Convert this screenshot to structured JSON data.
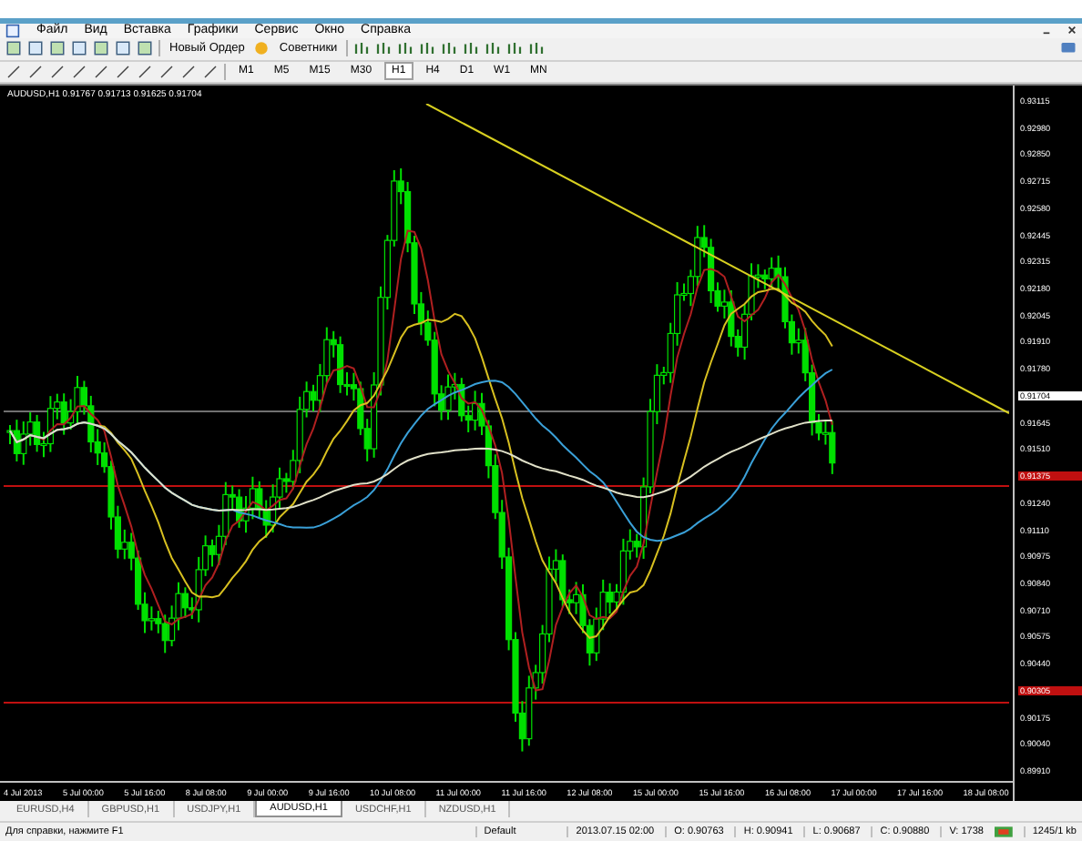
{
  "menu": [
    "Файл",
    "Вид",
    "Вставка",
    "Графики",
    "Сервис",
    "Окно",
    "Справка"
  ],
  "toolbar": {
    "new_order": "Новый Ордер",
    "experts": "Советники"
  },
  "timeframes": [
    {
      "label": "M1",
      "selected": false
    },
    {
      "label": "M5",
      "selected": false
    },
    {
      "label": "M15",
      "selected": false
    },
    {
      "label": "M30",
      "selected": false
    },
    {
      "label": "H1",
      "selected": true
    },
    {
      "label": "H4",
      "selected": false
    },
    {
      "label": "D1",
      "selected": false
    },
    {
      "label": "W1",
      "selected": false
    },
    {
      "label": "MN",
      "selected": false
    }
  ],
  "chart": {
    "header": "AUDUSD,H1 0.91767 0.91713 0.91625 0.91704",
    "price_labels": [
      {
        "text": "0.93115",
        "kind": "tick"
      },
      {
        "text": "0.92980",
        "kind": "tick"
      },
      {
        "text": "0.92850",
        "kind": "tick"
      },
      {
        "text": "0.92715",
        "kind": "tick"
      },
      {
        "text": "0.92580",
        "kind": "tick"
      },
      {
        "text": "0.92445",
        "kind": "tick"
      },
      {
        "text": "0.92315",
        "kind": "tick"
      },
      {
        "text": "0.92180",
        "kind": "tick"
      },
      {
        "text": "0.92045",
        "kind": "tick"
      },
      {
        "text": "0.91910",
        "kind": "tick"
      },
      {
        "text": "0.91780",
        "kind": "tick"
      },
      {
        "text": "0.91704",
        "kind": "current"
      },
      {
        "text": "0.91645",
        "kind": "tick"
      },
      {
        "text": "0.91510",
        "kind": "tick"
      },
      {
        "text": "0.91375",
        "kind": "level"
      },
      {
        "text": "0.91240",
        "kind": "tick"
      },
      {
        "text": "0.91110",
        "kind": "tick"
      },
      {
        "text": "0.90975",
        "kind": "tick"
      },
      {
        "text": "0.90840",
        "kind": "tick"
      },
      {
        "text": "0.90710",
        "kind": "tick"
      },
      {
        "text": "0.90575",
        "kind": "tick"
      },
      {
        "text": "0.90440",
        "kind": "tick"
      },
      {
        "text": "0.90305",
        "kind": "level"
      },
      {
        "text": "0.90175",
        "kind": "tick"
      },
      {
        "text": "0.90040",
        "kind": "tick"
      },
      {
        "text": "0.89910",
        "kind": "tick"
      }
    ],
    "time_labels": [
      "4 Jul 2013",
      "5 Jul 00:00",
      "5 Jul 16:00",
      "8 Jul 08:00",
      "9 Jul 00:00",
      "9 Jul 16:00",
      "10 Jul 08:00",
      "11 Jul 00:00",
      "11 Jul 16:00",
      "12 Jul 08:00",
      "15 Jul 00:00",
      "15 Jul 16:00",
      "16 Jul 08:00",
      "17 Jul 00:00",
      "17 Jul 16:00",
      "18 Jul 08:00"
    ]
  },
  "tabs": [
    {
      "label": "EURUSD,H4",
      "selected": false
    },
    {
      "label": "GBPUSD,H1",
      "selected": false
    },
    {
      "label": "USDJPY,H1",
      "selected": false
    },
    {
      "label": "AUDUSD,H1",
      "selected": true
    },
    {
      "label": "USDCHF,H1",
      "selected": false
    },
    {
      "label": "NZDUSD,H1",
      "selected": false
    }
  ],
  "status_bar": {
    "help": "Для справки, нажмите F1",
    "profile": "Default",
    "time": "2013.07.15 02:00",
    "open": "O: 0.90763",
    "high": "H: 0.90941",
    "low": "L: 0.90687",
    "close": "C: 0.90880",
    "volume": "V: 1738",
    "traffic": "1245/1 kb"
  }
}
